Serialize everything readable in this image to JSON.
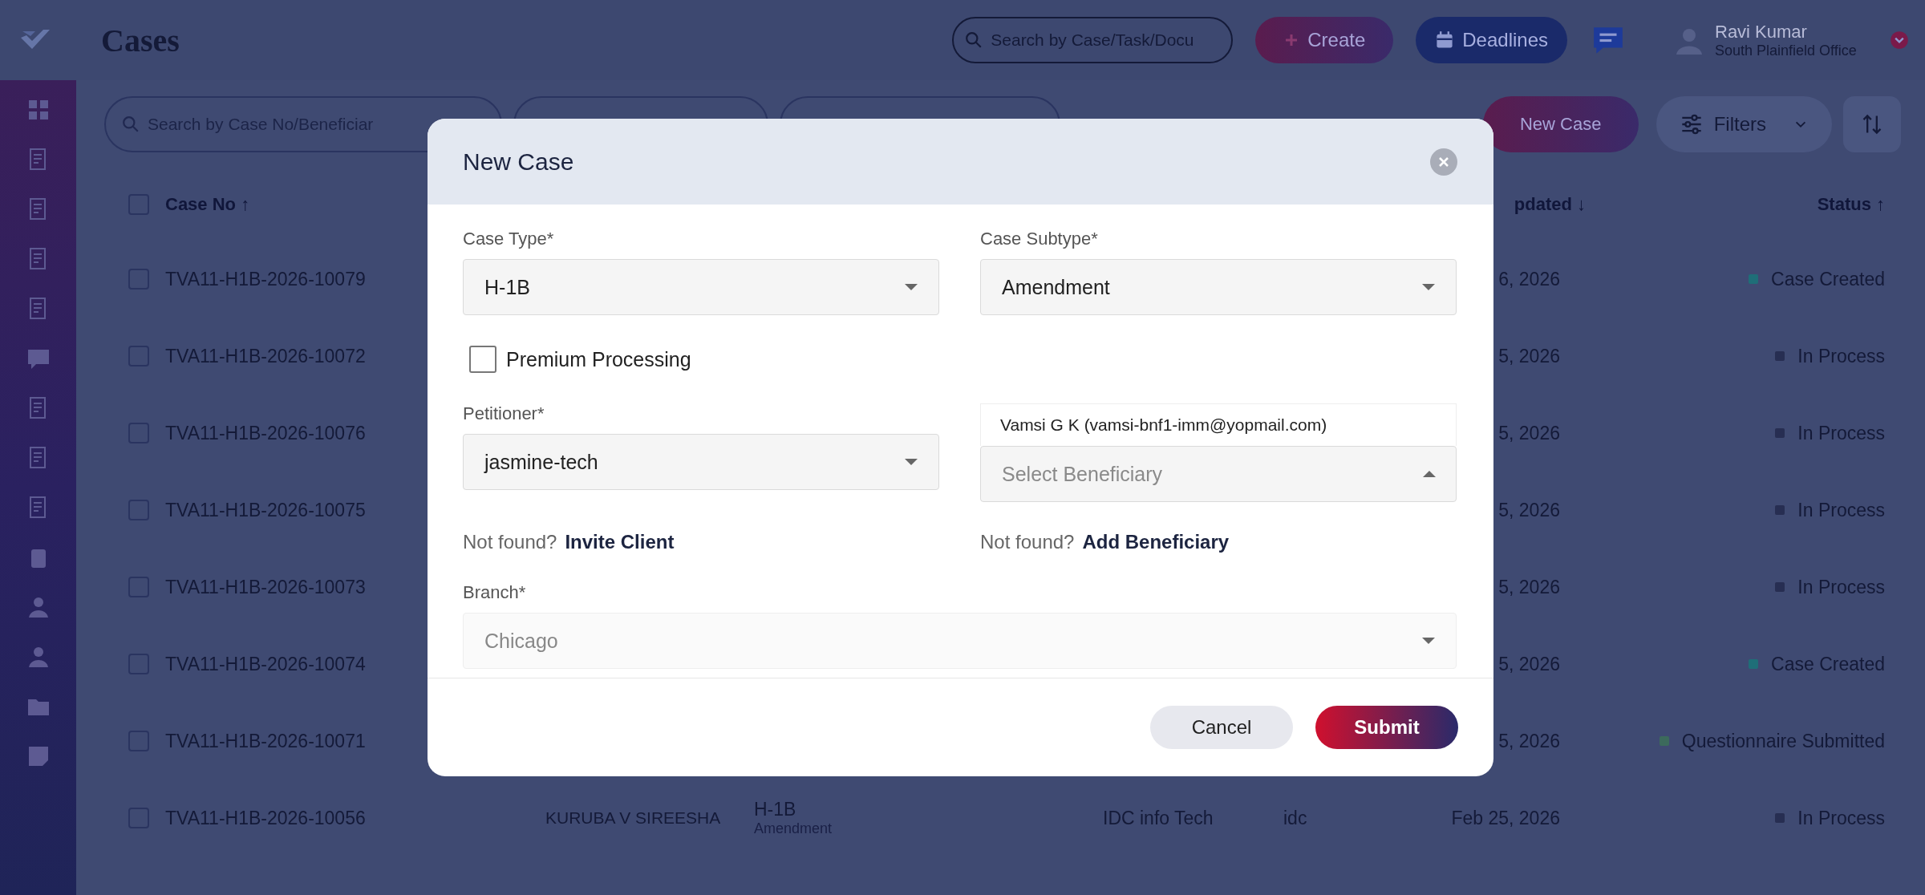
{
  "app": {
    "title": "Cases",
    "search": {
      "placeholder": "Search by Case/Task/Docu"
    },
    "create_button": "Create",
    "deadlines_button": "Deadlines",
    "user": {
      "name": "Ravi Kumar",
      "office": "South Plainfield Office"
    }
  },
  "toolbar": {
    "search": {
      "placeholder": "Search by Case No/Beneficiar"
    },
    "new_case_button": "New Case",
    "filters_button": "Filters"
  },
  "table": {
    "columns": [
      "Case No ↑",
      "pdated ↓",
      "Status ↑"
    ],
    "select_all_checked": false,
    "rows": [
      {
        "checked": false,
        "case_no": "TVA11-H1B-2026-10079",
        "updated": "6, 2026",
        "status": "Case Created",
        "color": "#1f6e78"
      },
      {
        "checked": false,
        "case_no": "TVA11-H1B-2026-10072",
        "updated": "5, 2026",
        "status": "In Process",
        "color": "#272e52"
      },
      {
        "checked": false,
        "case_no": "TVA11-H1B-2026-10076",
        "updated": "5, 2026",
        "status": "In Process",
        "color": "#272e52"
      },
      {
        "checked": false,
        "case_no": "TVA11-H1B-2026-10075",
        "updated": "5, 2026",
        "status": "In Process",
        "color": "#272e52"
      },
      {
        "checked": false,
        "case_no": "TVA11-H1B-2026-10073",
        "updated": "5, 2026",
        "status": "In Process",
        "color": "#272e52"
      },
      {
        "checked": false,
        "case_no": "TVA11-H1B-2026-10074",
        "updated": "5, 2026",
        "status": "Case Created",
        "color": "#1f6e78"
      },
      {
        "checked": false,
        "case_no": "TVA11-H1B-2026-10071",
        "updated": "5, 2026",
        "status": "Questionnaire Submitted",
        "color": "#3c6a5c"
      },
      {
        "checked": false,
        "case_no": "TVA11-H1B-2026-10056",
        "column_2": "KURUBA V SIREESHA",
        "column_3": "H-1B",
        "column_3_sub": "Amendment",
        "column_4": "IDC info Tech",
        "column_5": "idc",
        "updated": "Feb 25, 2026",
        "status": "In Process",
        "color": "#272e52"
      }
    ]
  },
  "modal": {
    "title": "New Case",
    "case_type": {
      "label": "Case Type*",
      "value": "H-1B"
    },
    "case_subtype": {
      "label": "Case Subtype*",
      "value": "Amendment"
    },
    "premium": {
      "label": "Premium Processing",
      "checked": false
    },
    "petitioner": {
      "label": "Petitioner*",
      "value": "jasmine-tech"
    },
    "beneficiary": {
      "placeholder": "Select Beneficiary",
      "expanded": true,
      "options": [
        "Vamsi G K (vamsi-bnf1-imm@yopmail.com)"
      ]
    },
    "invite": {
      "prefix": "Not found?",
      "link": "Invite Client"
    },
    "add": {
      "prefix": "Not found?",
      "link": "Add Beneficiary"
    },
    "branch": {
      "label": "Branch*",
      "value": "Chicago",
      "disabled": true
    },
    "cancel_button": "Cancel",
    "submit_button": "Submit"
  }
}
